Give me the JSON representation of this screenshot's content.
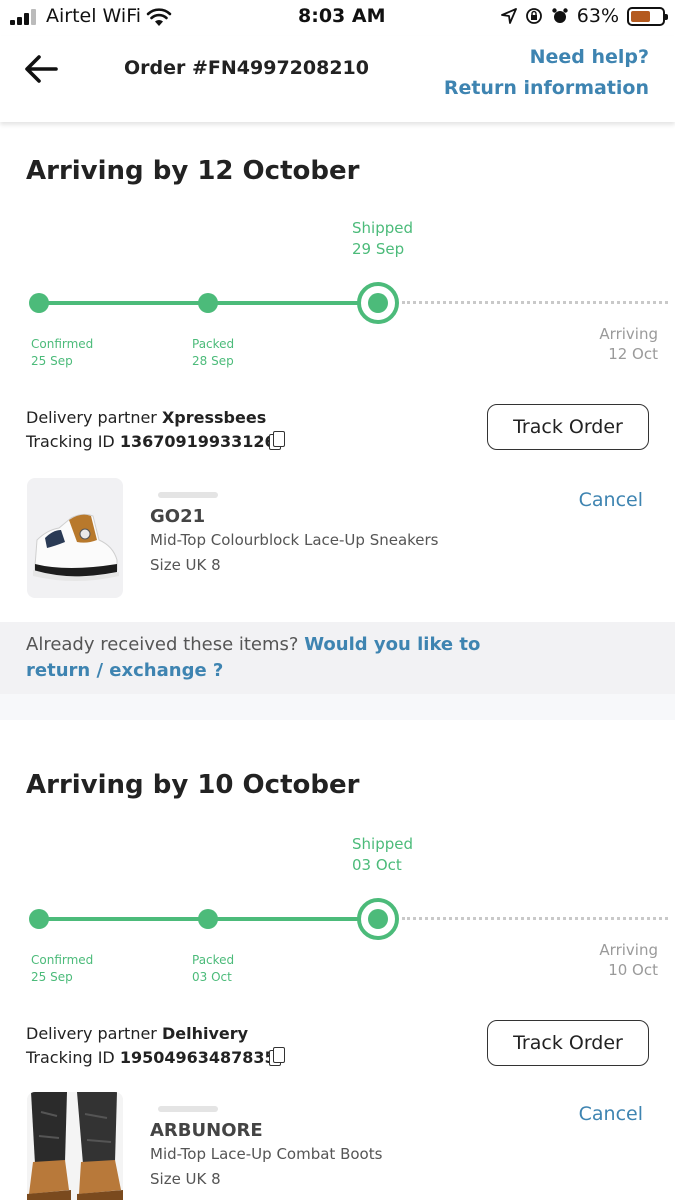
{
  "status_bar": {
    "carrier": "Airtel WiFi",
    "time": "8:03 AM",
    "battery": "63%",
    "battery_level": 0.63
  },
  "header": {
    "order_title": "Order #FN4997208210",
    "need_help": "Need help?",
    "return_information": "Return information"
  },
  "shipments": [
    {
      "arriving_title": "Arriving by 12 October",
      "shipped_label": "Shipped",
      "shipped_date": "29 Sep",
      "confirmed_label": "Confirmed",
      "confirmed_date": "25 Sep",
      "packed_label": "Packed",
      "packed_date": "28 Sep",
      "arriving_label": "Arriving",
      "arriving_date": "12 Oct",
      "partner_prefix": "Delivery partner",
      "partner_name": "Xpressbees",
      "tracking_prefix": "Tracking ID",
      "tracking_id": "13670919933126",
      "track_button": "Track Order",
      "item_brand": "GO21",
      "item_name": "Mid-Top Colourblock Lace-Up Sneakers",
      "item_size": "Size UK 8",
      "cancel": "Cancel"
    },
    {
      "arriving_title": "Arriving by 10 October",
      "shipped_label": "Shipped",
      "shipped_date": "03 Oct",
      "confirmed_label": "Confirmed",
      "confirmed_date": "25 Sep",
      "packed_label": "Packed",
      "packed_date": "03 Oct",
      "arriving_label": "Arriving",
      "arriving_date": "10 Oct",
      "partner_prefix": "Delivery partner",
      "partner_name": "Delhivery",
      "tracking_prefix": "Tracking ID",
      "tracking_id": "19504963487835",
      "track_button": "Track Order",
      "item_brand": "ARBUNORE",
      "item_name": "Mid-Top Lace-Up Combat Boots",
      "item_size": "Size UK 8",
      "cancel": "Cancel"
    }
  ],
  "return_prompt": {
    "question": "Already received these items?",
    "link": "Would you like to return / exchange ?"
  },
  "colors": {
    "accent_green": "#4cbb7a",
    "link_blue": "#3e84b1"
  }
}
